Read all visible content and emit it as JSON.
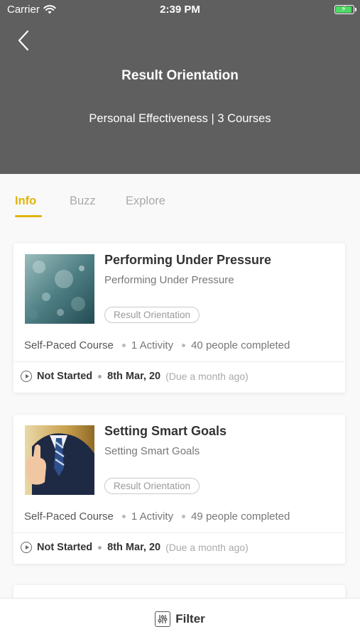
{
  "status_bar": {
    "carrier": "Carrier",
    "time": "2:39 PM"
  },
  "header": {
    "title": "Result Orientation",
    "subtitle": "Personal Effectiveness | 3 Courses"
  },
  "tabs": [
    {
      "label": "Info",
      "active": true
    },
    {
      "label": "Buzz",
      "active": false
    },
    {
      "label": "Explore",
      "active": false
    }
  ],
  "courses": [
    {
      "title": "Performing Under Pressure",
      "subtitle": "Performing Under Pressure",
      "tag": "Result Orientation",
      "type": "Self-Paced Course",
      "activities": "1 Activity",
      "completed": "40 people completed",
      "status": "Not Started",
      "date": "8th Mar, 20",
      "due": "(Due a month ago)",
      "thumbnail_icon": "rain-glass-image"
    },
    {
      "title": "Setting Smart Goals",
      "subtitle": "Setting Smart Goals",
      "tag": "Result Orientation",
      "type": "Self-Paced Course",
      "activities": "1 Activity",
      "completed": "49 people completed",
      "status": "Not Started",
      "date": "8th Mar, 20",
      "due": "(Due a month ago)",
      "thumbnail_icon": "businessman-thumbs-up-image"
    }
  ],
  "filter": {
    "label": "Filter"
  },
  "colors": {
    "header_bg": "#5f5f5f",
    "accent": "#e0b40c",
    "battery": "#4cd964"
  }
}
